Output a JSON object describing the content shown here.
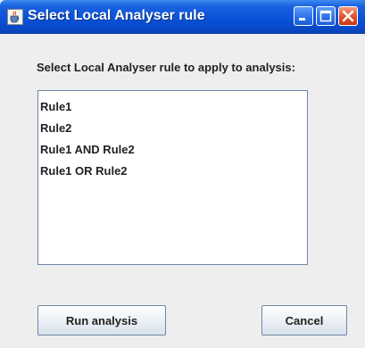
{
  "window": {
    "title": "Select Local Analyser rule",
    "icon": "java-cup-icon",
    "controls": {
      "minimize": "minimize-icon",
      "maximize": "maximize-icon",
      "close": "close-icon"
    }
  },
  "dialog": {
    "prompt": "Select Local Analyser rule to apply to analysis:",
    "rules": [
      "Rule1",
      "Rule2",
      "Rule1 AND Rule2",
      "Rule1 OR Rule2"
    ],
    "buttons": {
      "run": "Run analysis",
      "cancel": "Cancel"
    }
  },
  "colors": {
    "titlebar": "#0a52d8",
    "background": "#eeeeee",
    "list_border": "#6f87a8",
    "close_button": "#e2502a"
  }
}
